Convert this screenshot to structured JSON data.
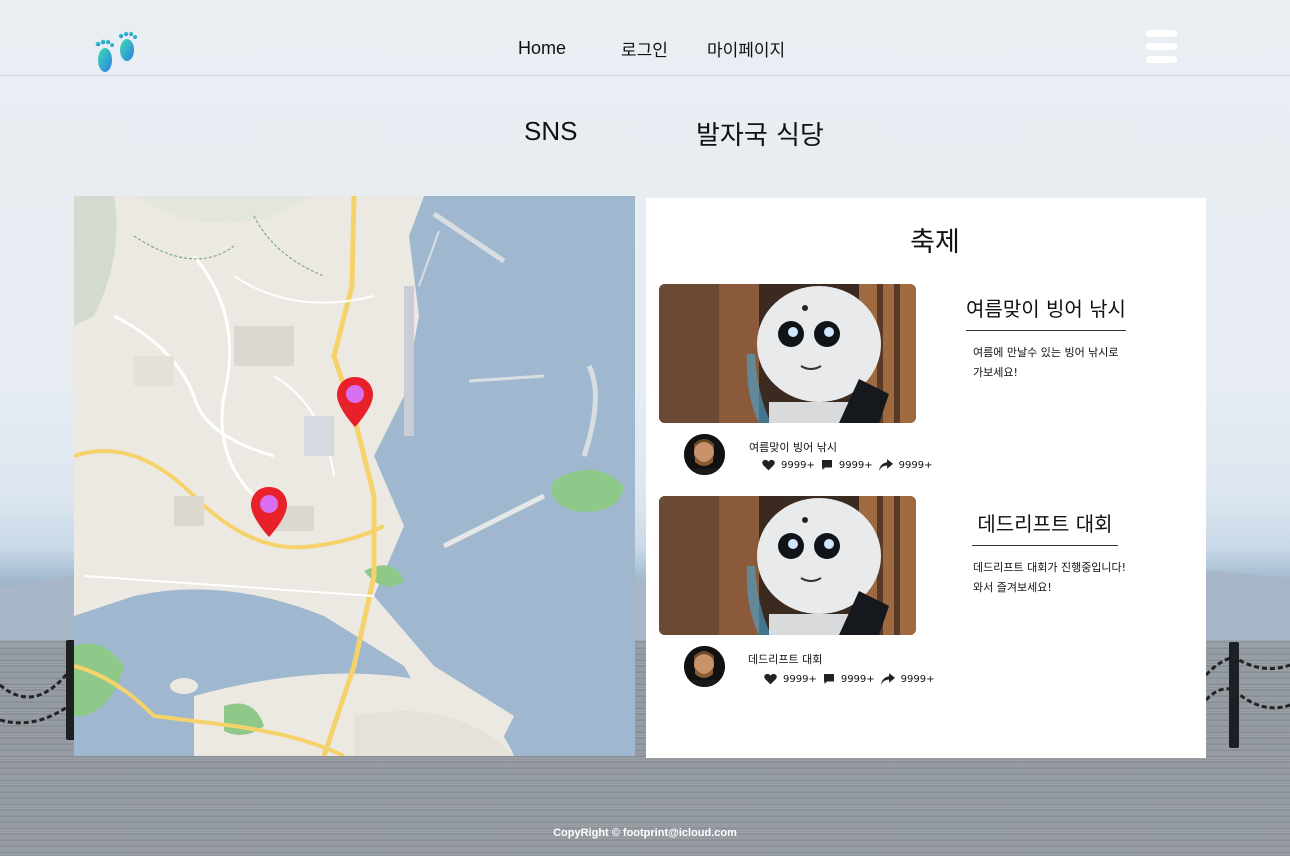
{
  "nav": {
    "home": "Home",
    "login": "로그인",
    "mypage": "마이페이지"
  },
  "tabs": {
    "sns": "SNS",
    "food": "발자국 식당"
  },
  "panel": {
    "title": "축제",
    "cards": [
      {
        "title": "여름맞이 빙어 낚시",
        "desc_line1": "여름에 만날수 있는 빙어 낚시로",
        "desc_line2": "가보세요!",
        "meta_title": "여름맞이 빙어 낚시",
        "likes": "9999+",
        "comments": "9999+",
        "shares": "9999+"
      },
      {
        "title": "데드리프트 대회",
        "desc_line1": "데드리프트 대회가 진행중입니다!",
        "desc_line2": "와서 즐겨보세요!",
        "meta_title": "데드리프트 대회",
        "likes": "9999+",
        "comments": "9999+",
        "shares": "9999+"
      }
    ]
  },
  "footer": {
    "text": "CopyRight © footprint@icloud.com"
  },
  "colors": {
    "marker": "#e8202a",
    "marker_dot": "#d86ef0",
    "sea": "#9fb8d0",
    "land": "#ece9e2",
    "park": "#8fc98a"
  }
}
